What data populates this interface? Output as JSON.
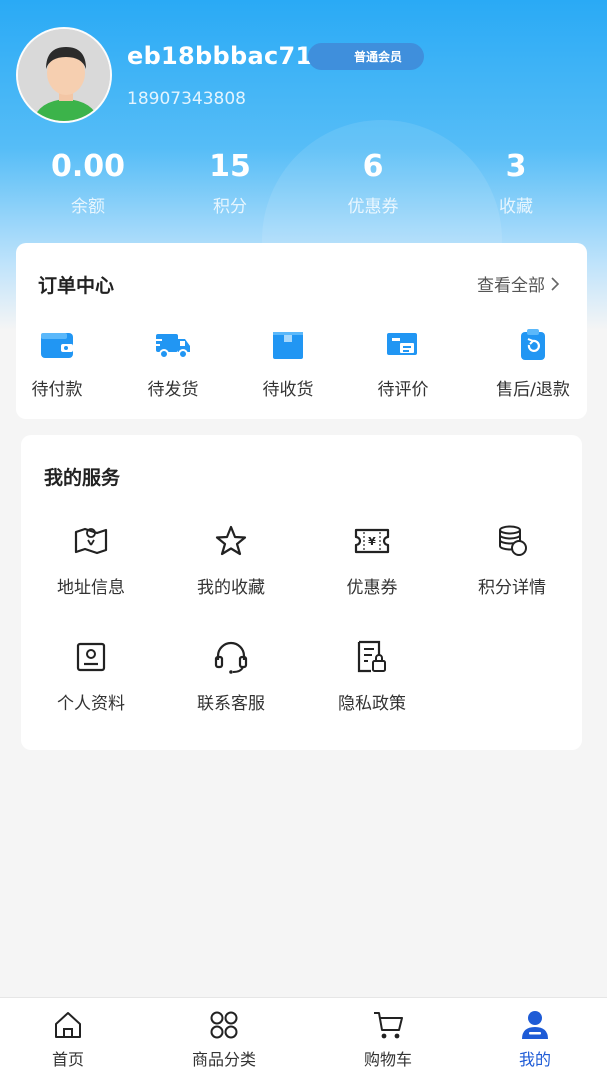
{
  "profile": {
    "username": "eb18bbbac717",
    "member_badge": "普通会员",
    "phone": "18907343808",
    "avatar_icon": "user-avatar"
  },
  "stats": [
    {
      "value": "0.00",
      "label": "余额"
    },
    {
      "value": "15",
      "label": "积分"
    },
    {
      "value": "6",
      "label": "优惠券"
    },
    {
      "value": "3",
      "label": "收藏"
    }
  ],
  "orders": {
    "title": "订单中心",
    "view_all": "查看全部",
    "items": [
      {
        "label": "待付款",
        "icon": "wallet-icon"
      },
      {
        "label": "待发货",
        "icon": "truck-icon"
      },
      {
        "label": "待收货",
        "icon": "package-icon"
      },
      {
        "label": "待评价",
        "icon": "review-icon"
      },
      {
        "label": "售后/退款",
        "icon": "refund-icon"
      }
    ]
  },
  "services": {
    "title": "我的服务",
    "items": [
      {
        "label": "地址信息",
        "icon": "map-icon"
      },
      {
        "label": "我的收藏",
        "icon": "star-icon"
      },
      {
        "label": "优惠券",
        "icon": "ticket-icon"
      },
      {
        "label": "积分详情",
        "icon": "coins-icon"
      },
      {
        "label": "个人资料",
        "icon": "profile-card-icon"
      },
      {
        "label": "联系客服",
        "icon": "headset-icon"
      },
      {
        "label": "隐私政策",
        "icon": "privacy-doc-icon"
      }
    ]
  },
  "tabbar": [
    {
      "label": "首页",
      "icon": "home-icon",
      "active": false
    },
    {
      "label": "商品分类",
      "icon": "category-icon",
      "active": false
    },
    {
      "label": "购物车",
      "icon": "cart-icon",
      "active": false
    },
    {
      "label": "我的",
      "icon": "user-icon",
      "active": true
    }
  ],
  "colors": {
    "accent": "#2aaaf5",
    "order_icon": "#2196f3",
    "tab_active": "#1e5bd6"
  }
}
